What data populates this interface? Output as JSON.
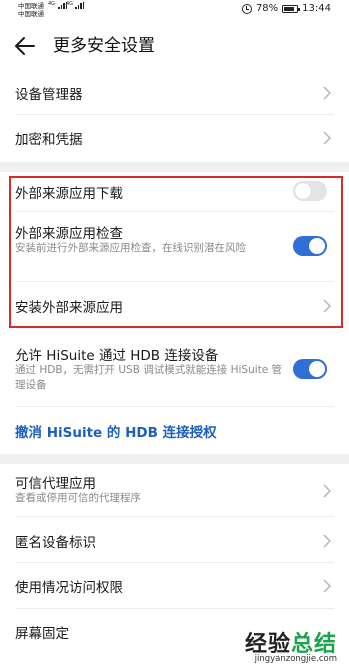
{
  "status_bar": {
    "carrier1": "中国联通",
    "carrier2": "中国联通",
    "net1": "4G",
    "net2": "4G",
    "battery_percent": "78%",
    "battery_level": 0.78,
    "time": "13:44"
  },
  "header": {
    "title": "更多安全设置",
    "back_icon": "back-arrow-icon"
  },
  "items": {
    "device_manager": "设备管理器",
    "encryption": "加密和凭据",
    "external_download": "外部来源应用下载",
    "external_download_on": false,
    "external_check": "外部来源应用检查",
    "external_check_desc": "安装前进行外部来源应用检查，在线识别潜在风险",
    "external_check_on": true,
    "install_external": "安装外部来源应用",
    "hisuite_allow": "允许 HiSuite 通过 HDB 连接设备",
    "hisuite_allow_desc": "通过 HDB，无需打开 USB 调试模式就能连接 HiSuite 管理设备",
    "hisuite_allow_on": true,
    "revoke_hisuite": "撤消 HiSuite 的 HDB 连接授权",
    "trusted_agents": "可信代理应用",
    "trusted_agents_desc": "查看或停用可信的代理程序",
    "anonymous_id": "匿名设备标识",
    "usage_access": "使用情况访问权限",
    "screen_pin": "屏幕固定"
  },
  "colors": {
    "accent": "#2f6fd6",
    "link": "#1d5fbf",
    "highlight_border": "#d32a2a"
  },
  "watermark": {
    "logo_part1": "经验",
    "logo_part2": "总结",
    "url": "jingyanzongjie.com"
  }
}
